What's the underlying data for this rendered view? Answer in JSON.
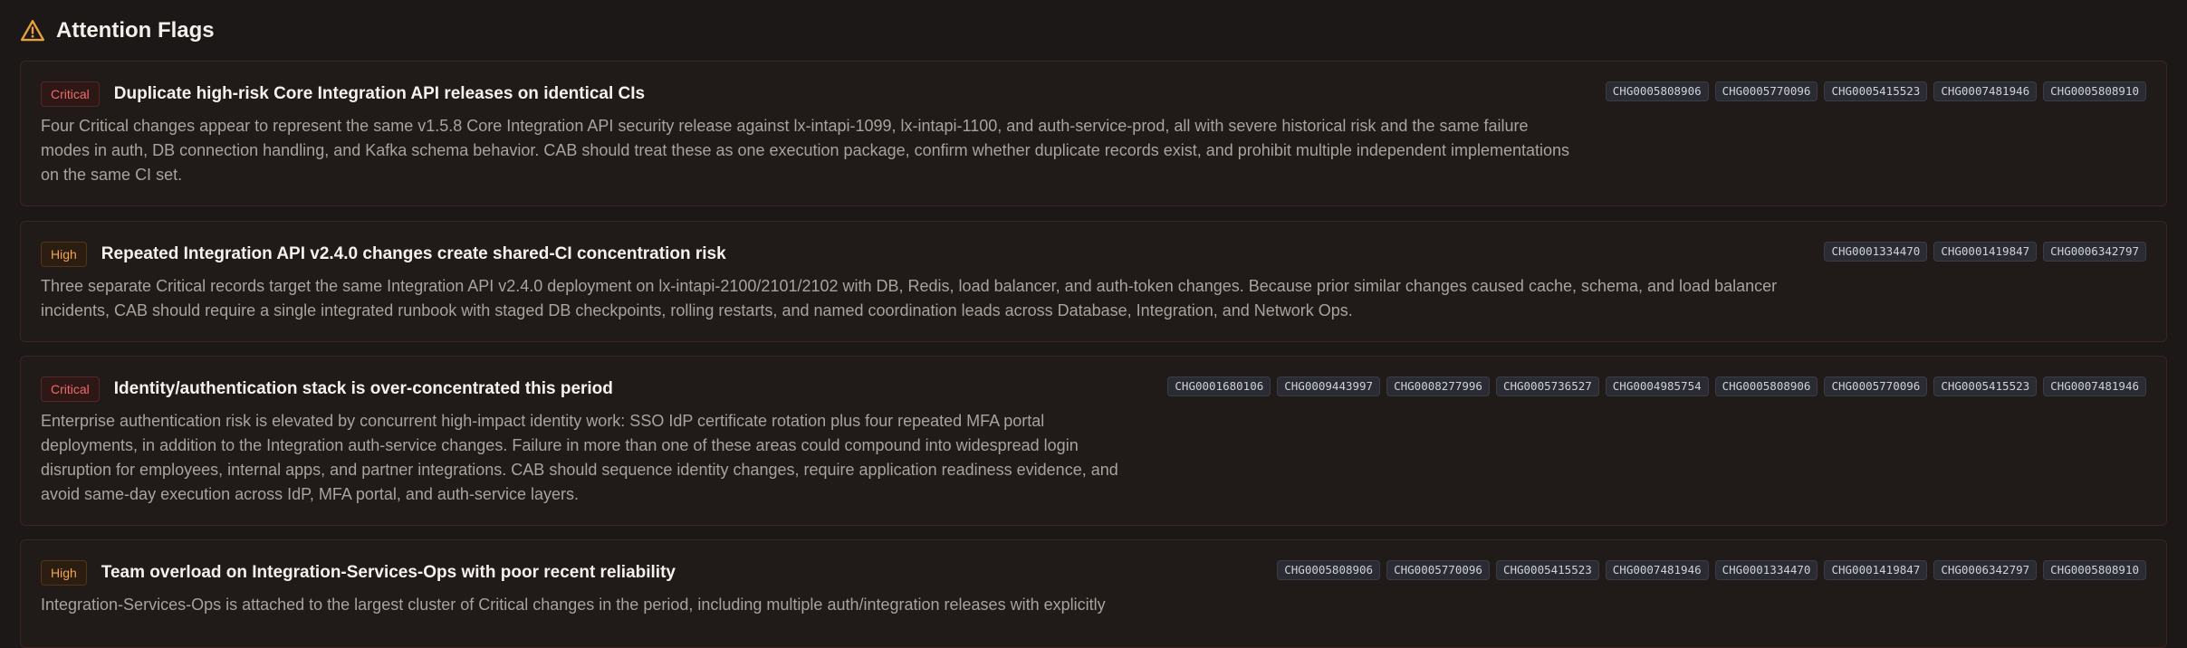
{
  "header": {
    "title": "Attention Flags",
    "icon": "warning-triangle-icon",
    "icon_color": "#e8a23a"
  },
  "flags": [
    {
      "severity": "Critical",
      "title": "Duplicate high-risk Core Integration API releases on identical CIs",
      "description": "Four Critical changes appear to represent the same v1.5.8 Core Integration API security release against lx-intapi-1099, lx-intapi-1100, and auth-service-prod, all with severe historical risk and the same failure modes in auth, DB connection handling, and Kafka schema behavior. CAB should treat these as one execution package, confirm whether duplicate records exist, and prohibit multiple independent implementations on the same CI set.",
      "tags": [
        "CHG0005808906",
        "CHG0005770096",
        "CHG0005415523",
        "CHG0007481946",
        "CHG0005808910"
      ]
    },
    {
      "severity": "High",
      "title": "Repeated Integration API v2.4.0 changes create shared-CI concentration risk",
      "description": "Three separate Critical records target the same Integration API v2.4.0 deployment on lx-intapi-2100/2101/2102 with DB, Redis, load balancer, and auth-token changes. Because prior similar changes caused cache, schema, and load balancer incidents, CAB should require a single integrated runbook with staged DB checkpoints, rolling restarts, and named coordination leads across Database, Integration, and Network Ops.",
      "tags": [
        "CHG0001334470",
        "CHG0001419847",
        "CHG0006342797"
      ]
    },
    {
      "severity": "Critical",
      "title": "Identity/authentication stack is over-concentrated this period",
      "description": "Enterprise authentication risk is elevated by concurrent high-impact identity work: SSO IdP certificate rotation plus four repeated MFA portal deployments, in addition to the Integration auth-service changes. Failure in more than one of these areas could compound into widespread login disruption for employees, internal apps, and partner integrations. CAB should sequence identity changes, require application readiness evidence, and avoid same-day execution across IdP, MFA portal, and auth-service layers.",
      "tags": [
        "CHG0001680106",
        "CHG0009443997",
        "CHG0008277996",
        "CHG0005736527",
        "CHG0004985754",
        "CHG0005808906",
        "CHG0005770096",
        "CHG0005415523",
        "CHG0007481946"
      ]
    },
    {
      "severity": "High",
      "title": "Team overload on Integration-Services-Ops with poor recent reliability",
      "description": "Integration-Services-Ops is attached to the largest cluster of Critical changes in the period, including multiple auth/integration releases with explicitly",
      "tags": [
        "CHG0005808906",
        "CHG0005770096",
        "CHG0005415523",
        "CHG0007481946",
        "CHG0001334470",
        "CHG0001419847",
        "CHG0006342797",
        "CHG0005808910"
      ]
    }
  ],
  "colors": {
    "background": "#1b1817",
    "card_background": "#201a19",
    "card_border": "#3e2422",
    "critical": "#ef6b6b",
    "high": "#f0a456"
  }
}
